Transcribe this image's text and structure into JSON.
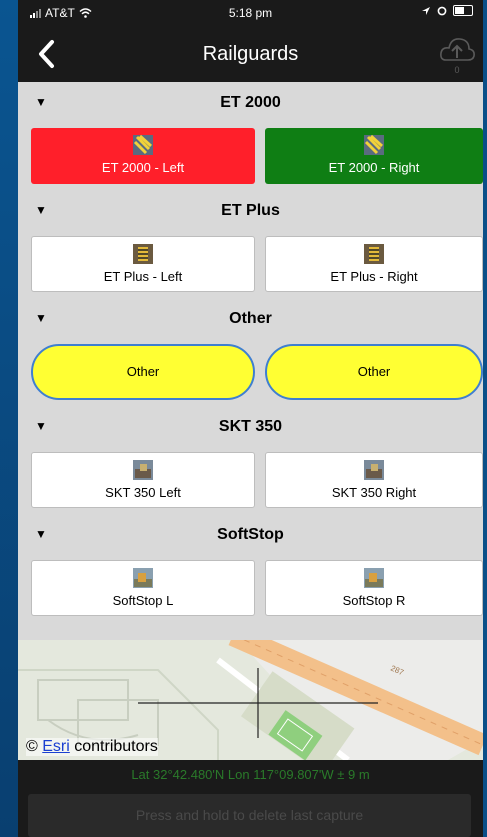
{
  "status_bar": {
    "carrier": "AT&T",
    "time": "5:18 pm"
  },
  "nav": {
    "title": "Railguards",
    "upload_count": "0"
  },
  "sections": [
    {
      "title": "ET 2000",
      "left": {
        "label": "ET 2000 - Left",
        "color": "#ff1f2a"
      },
      "right": {
        "label": "ET 2000 - Right",
        "color": "#0f7e14"
      }
    },
    {
      "title": "ET Plus",
      "left": {
        "label": "ET Plus - Left"
      },
      "right": {
        "label": "ET Plus - Right"
      }
    },
    {
      "title": "Other",
      "left": {
        "label": "Other",
        "color": "#ffff33"
      },
      "right": {
        "label": "Other",
        "color": "#ffff33"
      }
    },
    {
      "title": "SKT 350",
      "left": {
        "label": "SKT 350 Left"
      },
      "right": {
        "label": "SKT 350 Right"
      }
    },
    {
      "title": "SoftStop",
      "left": {
        "label": "SoftStop L"
      },
      "right": {
        "label": "SoftStop R"
      }
    }
  ],
  "map": {
    "attribution_link": "Esri",
    "attribution_text": " contributors",
    "attribution_symbol": "©",
    "road_label": "287"
  },
  "coordinates": "Lat 32°42.480'N Lon 117°09.807'W ± 9 m",
  "capture_hint": "Press and hold to delete last capture"
}
